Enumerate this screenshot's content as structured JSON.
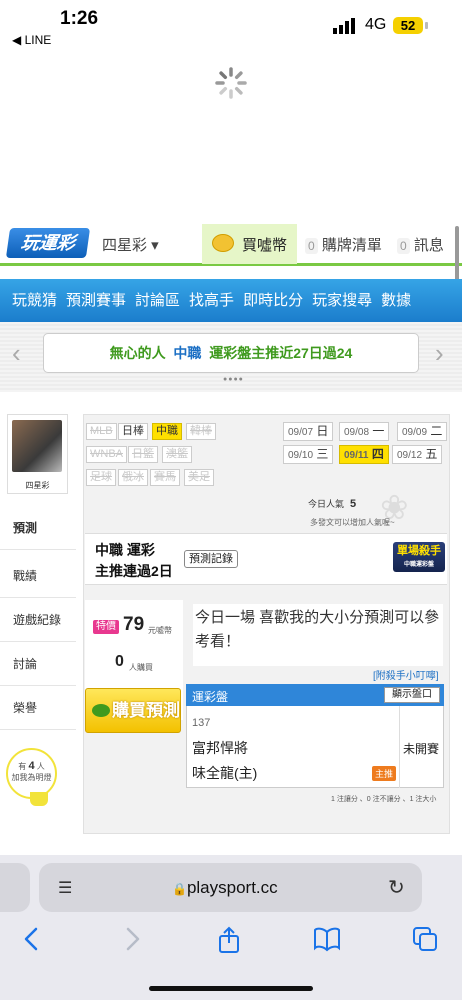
{
  "status_bar": {
    "time": "1:26",
    "back_app": "◀ LINE",
    "network": "4G",
    "battery": "52"
  },
  "header": {
    "logo": "玩運彩",
    "game_select": "四星彩 ▾",
    "buy_coin": "買噓幣",
    "cart_count": "0",
    "cart_label": "購牌清單",
    "msg_count": "0",
    "msg_label": "訊息"
  },
  "nav": {
    "items": [
      "玩競猜",
      "預測賽事",
      "討論區",
      "找高手",
      "即時比分",
      "玩家搜尋",
      "數據"
    ]
  },
  "banner": {
    "user": "無心的人",
    "league": "中職",
    "text": "運彩盤主推近27日過24",
    "prev": "‹",
    "next": "›",
    "dots": "●●●●"
  },
  "profile": {
    "name": "四星彩"
  },
  "sidebar": {
    "items": [
      "預測",
      "戰績",
      "遊戲紀錄",
      "討論",
      "榮譽"
    ]
  },
  "badge": {
    "line1": "有",
    "count": "4",
    "unit": "人",
    "line2": "加我為明燈"
  },
  "leagues": {
    "row1": [
      "MLB",
      "日棒",
      "中職",
      "韓棒"
    ],
    "row2": [
      "WNBA",
      "日籃",
      "澳籃"
    ],
    "row3": [
      "足球",
      "俄冰",
      "賽馬",
      "美足"
    ]
  },
  "dates": [
    {
      "date": "09/07",
      "day": "日"
    },
    {
      "date": "09/08",
      "day": "一"
    },
    {
      "date": "09/09",
      "day": "二"
    },
    {
      "date": "09/10",
      "day": "三"
    },
    {
      "date": "09/11",
      "day": "四"
    },
    {
      "date": "09/12",
      "day": "五"
    }
  ],
  "popularity": {
    "label": "今日人氣",
    "value": "5",
    "hint": "多發文可以增加人氣喔~"
  },
  "headline": {
    "line1": "中職 運彩",
    "line2": "主推連過2日",
    "record_btn": "預測記錄",
    "killer_title": "單場殺手",
    "killer_sub": "中職運彩盤"
  },
  "pricing": {
    "special": "特價",
    "price": "79",
    "price_unit": "元噓幣",
    "buyers": "0",
    "buyers_unit": "人購買",
    "buy_btn": "購買預測"
  },
  "description": "今日一場 喜歡我的大小分預測可以參考看！",
  "hint_link": "[附殺手小叮嚀]",
  "game_table": {
    "title": "運彩盤",
    "show_btn": "顯示盤口",
    "number": "137",
    "team1": "富邦悍將",
    "team2": "味全龍(主)",
    "status": "未開賽",
    "host_tag": "主推"
  },
  "legend": "1 注讓分 、0 注不讓分 、1 注大小",
  "browser": {
    "url": "playsport.cc",
    "lock": "🔒",
    "reader": "☰",
    "reload": "↻"
  },
  "colors": {
    "accent_green": "#7ac943",
    "nav_blue": "#1b7dcc",
    "highlight_yellow": "#ffe000"
  }
}
